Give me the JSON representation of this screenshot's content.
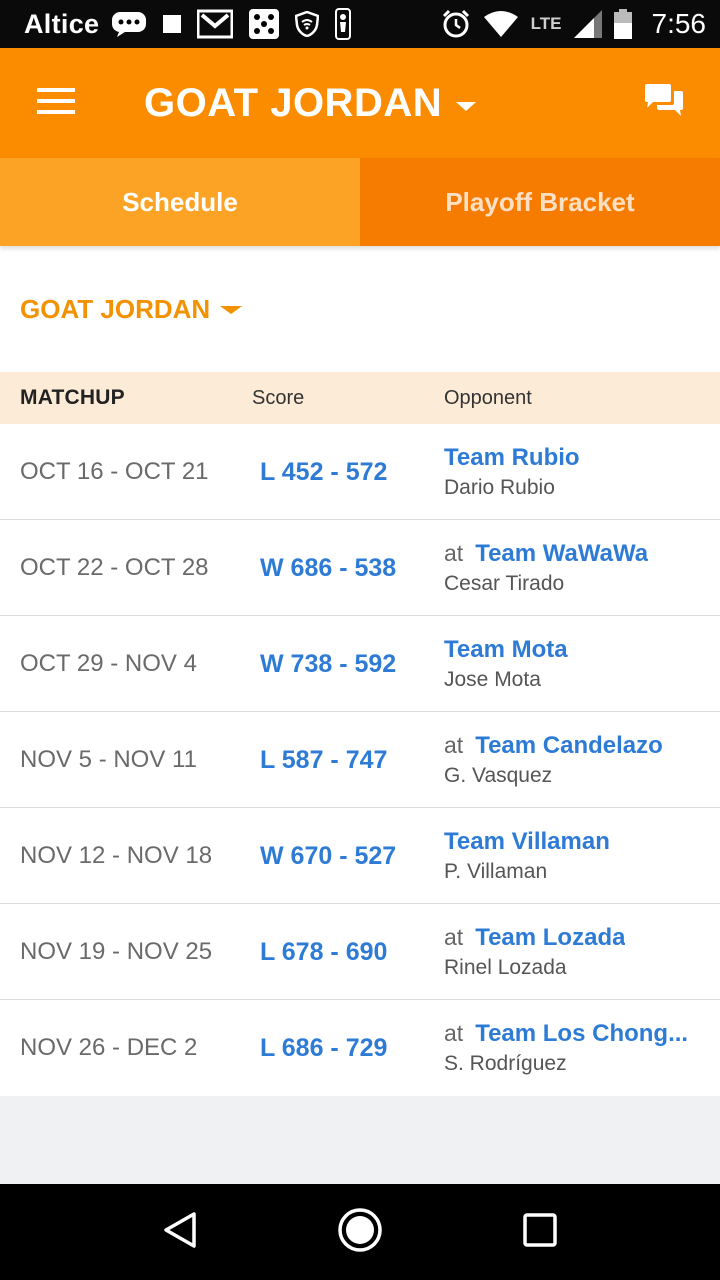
{
  "status_bar": {
    "carrier": "Altice",
    "network": "LTE",
    "time": "7:56",
    "icons": [
      "message-icon",
      "square-icon",
      "gmail-icon",
      "dice-icon",
      "wifi-shield-icon",
      "nba-icon",
      "alarm-icon",
      "wifi-icon",
      "signal-icon",
      "battery-icon"
    ]
  },
  "app_bar": {
    "title": "GOAT JORDAN",
    "menu_icon": "hamburger-menu-icon",
    "chat_icon": "chat-icon",
    "color": "#fb8c00"
  },
  "tabs": [
    {
      "label": "Schedule",
      "active": true
    },
    {
      "label": "Playoff Bracket",
      "active": false
    }
  ],
  "team_selector": {
    "label": "GOAT JORDAN"
  },
  "table": {
    "headers": {
      "matchup": "MATCHUP",
      "score": "Score",
      "opponent": "Opponent"
    },
    "rows": [
      {
        "dates": "OCT 16 - OCT 21",
        "score": "L 452 - 572",
        "at": "",
        "team": "Team Rubio",
        "manager": "Dario Rubio"
      },
      {
        "dates": "OCT 22 - OCT 28",
        "score": "W 686 - 538",
        "at": "at",
        "team": "Team WaWaWa",
        "manager": "Cesar Tirado"
      },
      {
        "dates": "OCT 29 - NOV 4",
        "score": "W 738 - 592",
        "at": "",
        "team": "Team Mota",
        "manager": "Jose Mota"
      },
      {
        "dates": "NOV 5 - NOV 11",
        "score": "L 587 - 747",
        "at": "at",
        "team": "Team Candelazo",
        "manager": "G. Vasquez"
      },
      {
        "dates": "NOV 12 - NOV 18",
        "score": "W 670 - 527",
        "at": "",
        "team": "Team Villaman",
        "manager": "P. Villaman"
      },
      {
        "dates": "NOV 19 - NOV 25",
        "score": "L 678 - 690",
        "at": "at",
        "team": "Team Lozada",
        "manager": "Rinel Lozada"
      },
      {
        "dates": "NOV 26 - DEC 2",
        "score": "L 686 - 729",
        "at": "at",
        "team": "Team Los Chong...",
        "manager": "S. Rodríguez"
      }
    ]
  },
  "nav_bar": {
    "buttons": [
      "back-icon",
      "home-icon",
      "recents-icon"
    ]
  },
  "colors": {
    "accent": "#fb8c00",
    "link": "#2e7bd6",
    "header_bg": "#fcebd6"
  }
}
